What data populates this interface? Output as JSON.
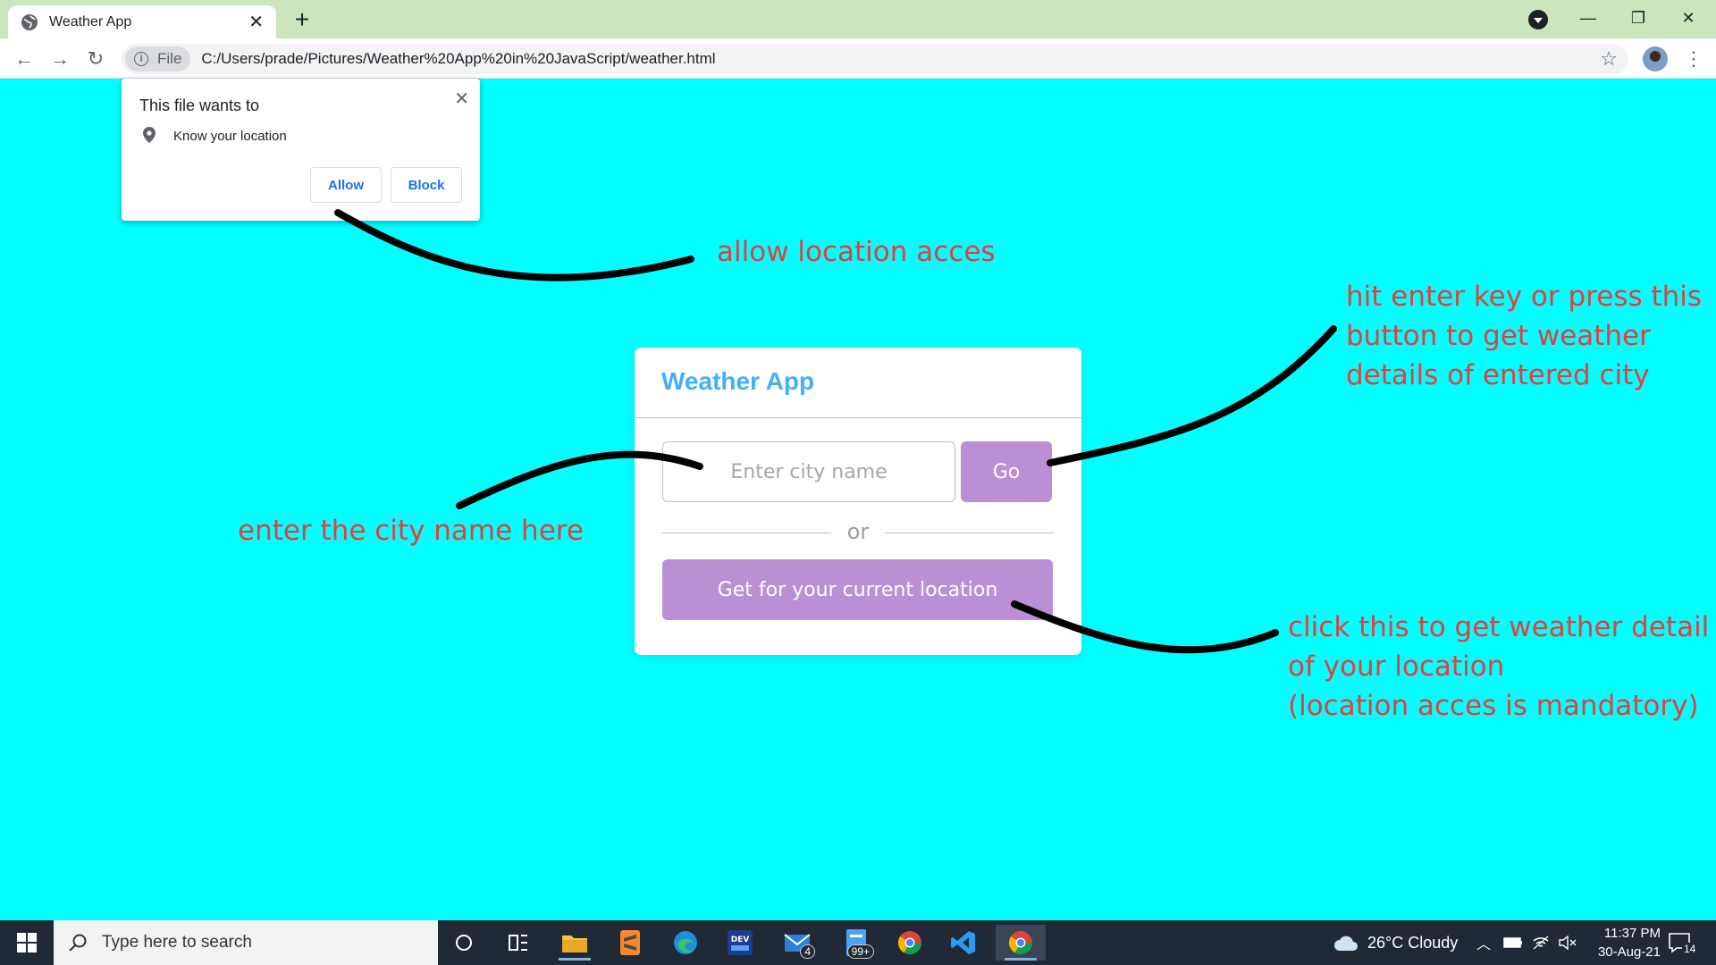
{
  "browser": {
    "tab_title": "Weather App",
    "url_chip": "File",
    "url": "C:/Users/prade/Pictures/Weather%20App%20in%20JavaScript/weather.html"
  },
  "permission_popup": {
    "title": "This file wants to",
    "request": "Know your location",
    "allow_label": "Allow",
    "block_label": "Block"
  },
  "app": {
    "title": "Weather App",
    "city_placeholder": "Enter city name",
    "go_label": "Go",
    "or_label": "or",
    "location_button_label": "Get for your current location",
    "accent_color": "#43affc",
    "button_color": "#bb8fd6",
    "page_background": "#00ffff"
  },
  "annotations": {
    "allow": "allow location acces",
    "go_button": "hit enter key or press this\nbutton to get weather\ndetails of entered city",
    "city_input": "enter the city name here",
    "location_button": "click this to get weather detail\nof your location\n(location acces is mandatory)",
    "annotation_color": "#e0413e"
  },
  "taskbar": {
    "search_placeholder": "Type here to search",
    "mail_badge": "4",
    "files_badge": "99+",
    "weather": "26°C  Cloudy",
    "time": "11:37 PM",
    "date": "30-Aug-21",
    "notifications": "14"
  }
}
